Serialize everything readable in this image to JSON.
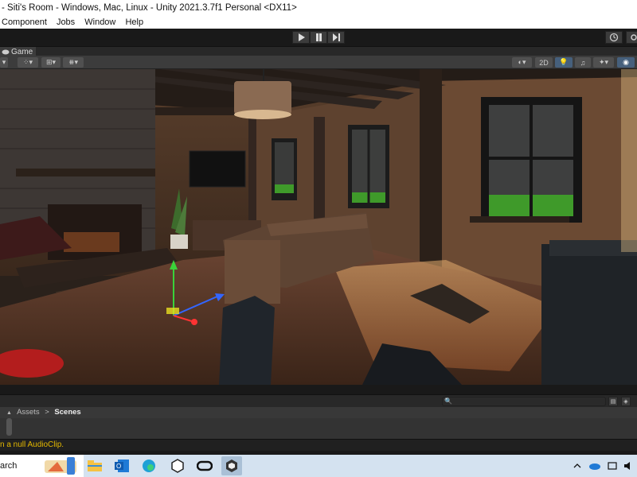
{
  "window": {
    "title": "- Siti's Room - Windows, Mac, Linux - Unity 2021.3.7f1 Personal <DX11>"
  },
  "menu": [
    "Component",
    "Jobs",
    "Window",
    "Help"
  ],
  "game_tab": {
    "label": "Game"
  },
  "scene_toolbar": {
    "mode_2d": "2D"
  },
  "project": {
    "breadcrumb_root": "Assets",
    "separator": ">",
    "breadcrumb_current": "Scenes"
  },
  "console": {
    "message": "n a null AudioClip."
  },
  "taskbar": {
    "search_text": "arch"
  },
  "colors": {
    "status_warning": "#e4b800",
    "active_toggle": "#46607c",
    "editor_dark": "#191919",
    "grass": "#3f9a2a"
  },
  "icons": [
    "play-icon",
    "pause-icon",
    "step-icon",
    "history-icon",
    "gear-icon",
    "search-icon",
    "edge-icon",
    "outlook-icon",
    "file-explorer-icon",
    "unity-icon",
    "wifi-icon",
    "volume-icon"
  ]
}
